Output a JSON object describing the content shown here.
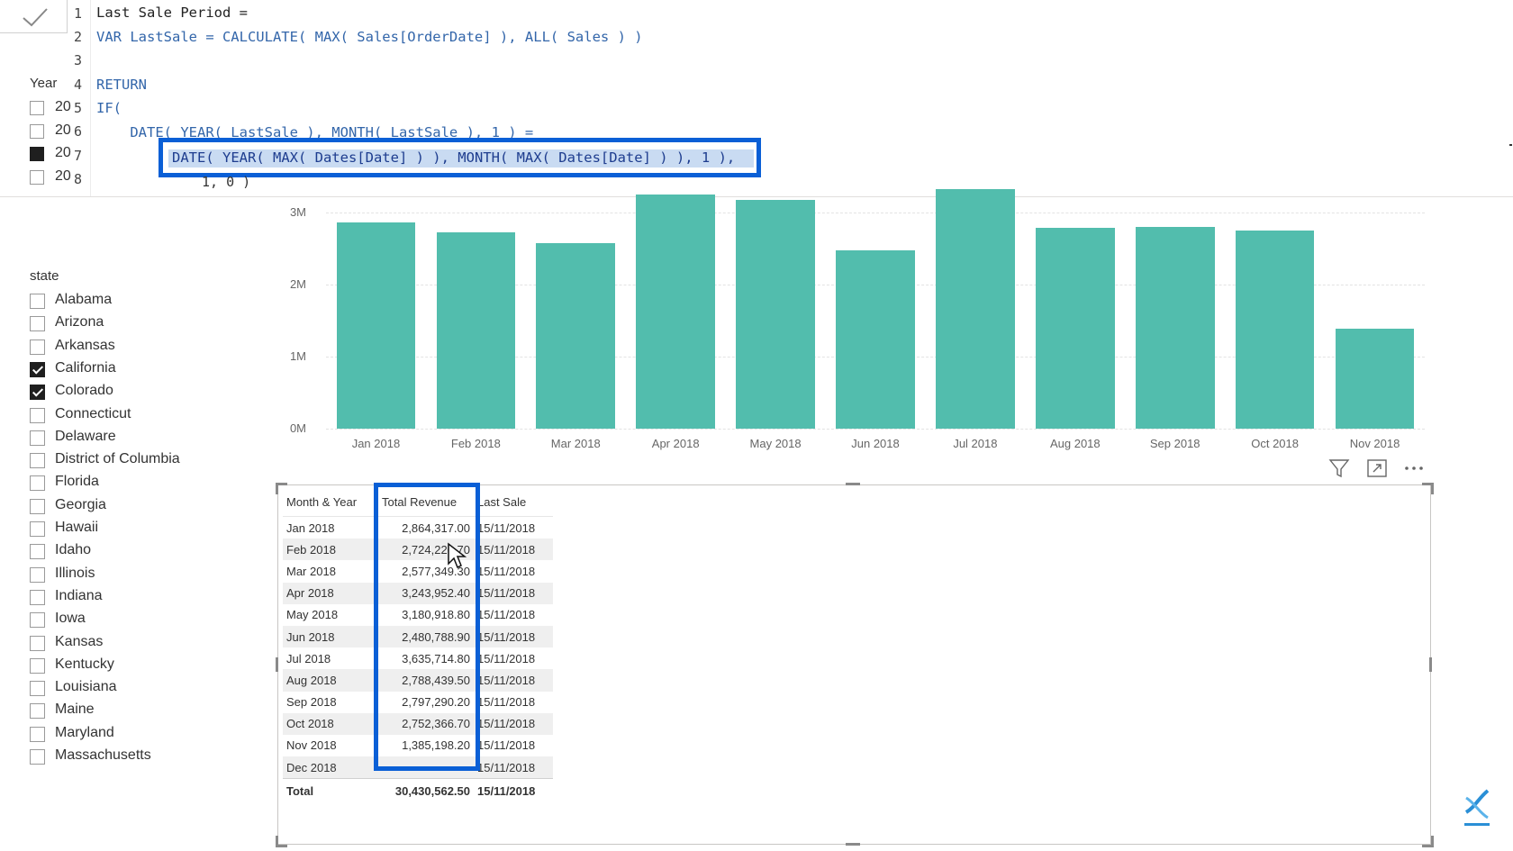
{
  "formula": {
    "lines": [
      {
        "num": "1",
        "text": "Last Sale Period ="
      },
      {
        "num": "2",
        "text": "VAR LastSale = CALCULATE( MAX( Sales[OrderDate] ), ALL( Sales ) )"
      },
      {
        "num": "3",
        "text": ""
      },
      {
        "num": "4",
        "text": "RETURN"
      },
      {
        "num": "5",
        "text": "IF("
      },
      {
        "num": "6",
        "text": "    DATE( YEAR( LastSale ), MONTH( LastSale ), 1 ) ="
      },
      {
        "num": "7",
        "text": "DATE( YEAR( MAX( Dates[Date] ) ), MONTH( MAX( Dates[Date] ) ), 1 ),"
      },
      {
        "num": "8",
        "text": "1, 0 )"
      }
    ]
  },
  "year_slicer": {
    "title": "Year",
    "items": [
      {
        "label": "20",
        "checked": false
      },
      {
        "label": "20",
        "checked": false
      },
      {
        "label": "20",
        "checked": true
      },
      {
        "label": "20",
        "checked": false
      }
    ]
  },
  "state_slicer": {
    "title": "state",
    "items": [
      {
        "label": "Alabama",
        "checked": false
      },
      {
        "label": "Arizona",
        "checked": false
      },
      {
        "label": "Arkansas",
        "checked": false
      },
      {
        "label": "California",
        "checked": true
      },
      {
        "label": "Colorado",
        "checked": true
      },
      {
        "label": "Connecticut",
        "checked": false
      },
      {
        "label": "Delaware",
        "checked": false
      },
      {
        "label": "District of Columbia",
        "checked": false
      },
      {
        "label": "Florida",
        "checked": false
      },
      {
        "label": "Georgia",
        "checked": false
      },
      {
        "label": "Hawaii",
        "checked": false
      },
      {
        "label": "Idaho",
        "checked": false
      },
      {
        "label": "Illinois",
        "checked": false
      },
      {
        "label": "Indiana",
        "checked": false
      },
      {
        "label": "Iowa",
        "checked": false
      },
      {
        "label": "Kansas",
        "checked": false
      },
      {
        "label": "Kentucky",
        "checked": false
      },
      {
        "label": "Louisiana",
        "checked": false
      },
      {
        "label": "Maine",
        "checked": false
      },
      {
        "label": "Maryland",
        "checked": false
      },
      {
        "label": "Massachusetts",
        "checked": false
      }
    ]
  },
  "chart_data": {
    "type": "bar",
    "categories": [
      "Jan 2018",
      "Feb 2018",
      "Mar 2018",
      "Apr 2018",
      "May 2018",
      "Jun 2018",
      "Jul 2018",
      "Aug 2018",
      "Sep 2018",
      "Oct 2018",
      "Nov 2018"
    ],
    "values": [
      2864317.0,
      2724220.7,
      2577349.3,
      3243952.4,
      3180918.8,
      2480788.9,
      3635714.8,
      2788439.5,
      2797290.2,
      2752366.7,
      1385198.2
    ],
    "yticks": [
      "0M",
      "1M",
      "2M",
      "3M"
    ],
    "ylim": [
      0,
      3000000
    ],
    "color": "#52bdad",
    "grid": true
  },
  "table": {
    "headers": [
      "Month & Year",
      "Total Revenue",
      "Last Sale"
    ],
    "rows": [
      [
        "Jan 2018",
        "2,864,317.00",
        "15/11/2018"
      ],
      [
        "Feb 2018",
        "2,724,220.70",
        "15/11/2018"
      ],
      [
        "Mar 2018",
        "2,577,349.30",
        "15/11/2018"
      ],
      [
        "Apr 2018",
        "3,243,952.40",
        "15/11/2018"
      ],
      [
        "May 2018",
        "3,180,918.80",
        "15/11/2018"
      ],
      [
        "Jun 2018",
        "2,480,788.90",
        "15/11/2018"
      ],
      [
        "Jul 2018",
        "3,635,714.80",
        "15/11/2018"
      ],
      [
        "Aug 2018",
        "2,788,439.50",
        "15/11/2018"
      ],
      [
        "Sep 2018",
        "2,797,290.20",
        "15/11/2018"
      ],
      [
        "Oct 2018",
        "2,752,366.70",
        "15/11/2018"
      ],
      [
        "Nov 2018",
        "1,385,198.20",
        "15/11/2018"
      ],
      [
        "Dec 2018",
        "",
        "15/11/2018"
      ]
    ],
    "total": [
      "Total",
      "30,430,562.50",
      "15/11/2018"
    ]
  },
  "icons": {
    "commit": "check-icon",
    "filter": "filter-icon",
    "focus": "focus-mode-icon",
    "more": "more-options-icon",
    "logo": "dna-subscribe-logo"
  },
  "accent_color": "#0a5fd6"
}
